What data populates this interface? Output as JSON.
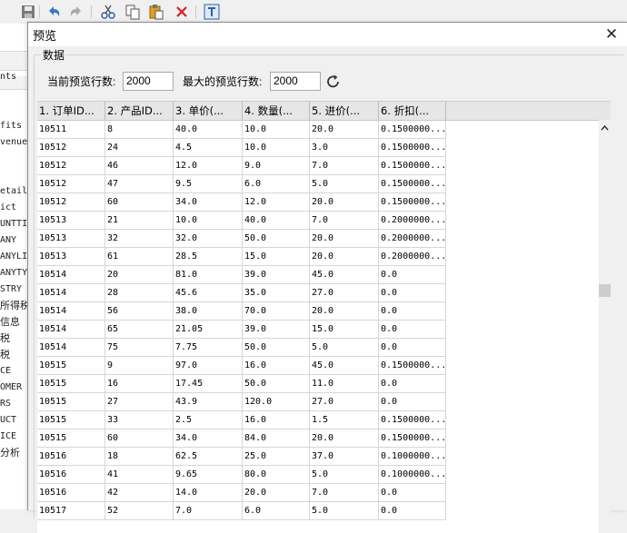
{
  "dialog": {
    "title": "预览",
    "group_label": "数据",
    "current_rows_label": "当前预览行数:",
    "current_rows_value": "2000",
    "max_rows_label": "最大的预览行数:",
    "max_rows_value": "2000"
  },
  "background": {
    "sidebar_items": [
      "nts",
      "fits",
      "venue",
      "etail",
      "ict",
      "UNTTI",
      "ANY",
      "ANYLIC",
      "ANYTY",
      "STRY",
      "所得税",
      "信息",
      "税",
      "税",
      "CE",
      "OMER",
      "RS",
      "UCT",
      "ICE",
      "分析"
    ]
  },
  "grid": {
    "columns": [
      "1. 订单ID...",
      "2. 产品ID...",
      "3. 单价(...",
      "4. 数量(...",
      "5. 进价(...",
      "6. 折扣(..."
    ],
    "rows": [
      [
        "10511",
        "8",
        "40.0",
        "10.0",
        "20.0",
        "0.1500000..."
      ],
      [
        "10512",
        "24",
        "4.5",
        "10.0",
        "3.0",
        "0.1500000..."
      ],
      [
        "10512",
        "46",
        "12.0",
        "9.0",
        "7.0",
        "0.1500000..."
      ],
      [
        "10512",
        "47",
        "9.5",
        "6.0",
        "5.0",
        "0.1500000..."
      ],
      [
        "10512",
        "60",
        "34.0",
        "12.0",
        "20.0",
        "0.1500000..."
      ],
      [
        "10513",
        "21",
        "10.0",
        "40.0",
        "7.0",
        "0.2000000..."
      ],
      [
        "10513",
        "32",
        "32.0",
        "50.0",
        "20.0",
        "0.2000000..."
      ],
      [
        "10513",
        "61",
        "28.5",
        "15.0",
        "20.0",
        "0.2000000..."
      ],
      [
        "10514",
        "20",
        "81.0",
        "39.0",
        "45.0",
        "0.0"
      ],
      [
        "10514",
        "28",
        "45.6",
        "35.0",
        "27.0",
        "0.0"
      ],
      [
        "10514",
        "56",
        "38.0",
        "70.0",
        "20.0",
        "0.0"
      ],
      [
        "10514",
        "65",
        "21.05",
        "39.0",
        "15.0",
        "0.0"
      ],
      [
        "10514",
        "75",
        "7.75",
        "50.0",
        "5.0",
        "0.0"
      ],
      [
        "10515",
        "9",
        "97.0",
        "16.0",
        "45.0",
        "0.1500000..."
      ],
      [
        "10515",
        "16",
        "17.45",
        "50.0",
        "11.0",
        "0.0"
      ],
      [
        "10515",
        "27",
        "43.9",
        "120.0",
        "27.0",
        "0.0"
      ],
      [
        "10515",
        "33",
        "2.5",
        "16.0",
        "1.5",
        "0.1500000..."
      ],
      [
        "10515",
        "60",
        "34.0",
        "84.0",
        "20.0",
        "0.1500000..."
      ],
      [
        "10516",
        "18",
        "62.5",
        "25.0",
        "37.0",
        "0.1000000..."
      ],
      [
        "10516",
        "41",
        "9.65",
        "80.0",
        "5.0",
        "0.1000000..."
      ],
      [
        "10516",
        "42",
        "14.0",
        "20.0",
        "7.0",
        "0.0"
      ],
      [
        "10517",
        "52",
        "7.0",
        "6.0",
        "5.0",
        "0.0"
      ]
    ]
  },
  "colors": {
    "undo_blue": "#3a78c4",
    "cut_blue": "#2c5fa8",
    "paste_orange": "#e0a020",
    "delete_red": "#d42020"
  }
}
